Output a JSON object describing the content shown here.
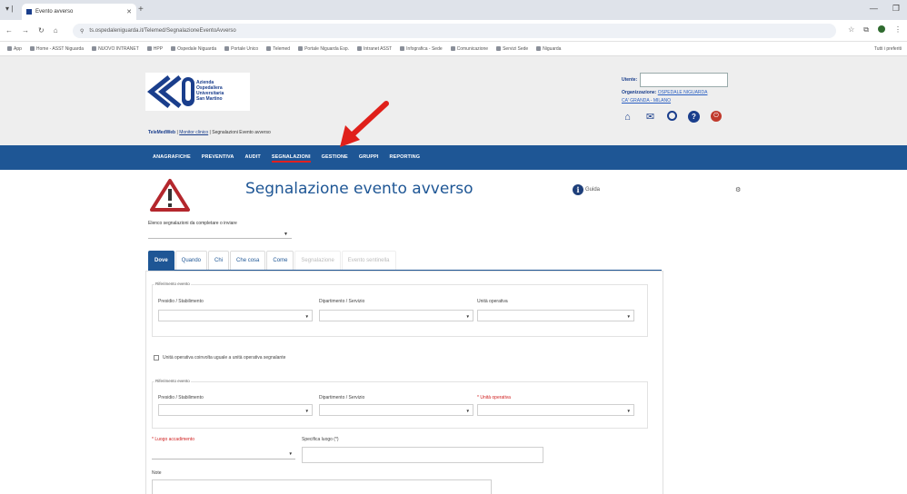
{
  "browser": {
    "tab_title": "Evento avverso",
    "url": "ts.ospedaleniguarda.it/Telemed/SegnalazioneEventoAvverso",
    "bookmarks": [
      "App",
      "Home - ASST Niguarda",
      "NUOVO INTRANET",
      "HPP",
      "Ospedale Niguarda",
      "Portale Unico",
      "Telemed",
      "Portale Niguarda Esp.",
      "Intranet ASST",
      "Infografica - Sede",
      "Comunicazione",
      "Servizi Sede",
      "Niguarda"
    ],
    "right_bookmark": "Tutti i preferiti"
  },
  "header": {
    "logo_lines": [
      "Azienda",
      "Ospedaliera",
      "Universitaria",
      "San Martino"
    ],
    "breadcrumb_home": "TeleMedWeb",
    "breadcrumb_link": "Monitor clinico",
    "breadcrumb_current": "Segnalazioni Evento avverso",
    "user_label": "Utente:",
    "org_label": "Organizzazione:",
    "org_value": "OSPEDALE NIGUARDA",
    "org_value2": "CA' GRANDA - MILANO"
  },
  "nav": {
    "items": [
      "ANAGRAFICHE",
      "PREVENTIVA",
      "AUDIT",
      "SEGNALAZIONI",
      "GESTIONE",
      "GRUPPI",
      "REPORTING"
    ]
  },
  "content": {
    "title": "Segnalazione evento avverso",
    "guide_label": "Guida",
    "elenco_label": "Elenco segnalazioni da completare o inviare",
    "tabs": [
      {
        "label": "Dove",
        "state": "active"
      },
      {
        "label": "Quando",
        "state": "normal"
      },
      {
        "label": "Chi",
        "state": "normal"
      },
      {
        "label": "Che cosa",
        "state": "normal"
      },
      {
        "label": "Come",
        "state": "normal"
      },
      {
        "label": "Segnalazione",
        "state": "disabled"
      },
      {
        "label": "Evento sentinella",
        "state": "disabled"
      }
    ],
    "section1_title": "Riferimento evento",
    "section1_fields": [
      "Presidio / Stabilimento",
      "Dipartimento / Servizio",
      "Unità operativa"
    ],
    "checkbox_label": "Unità operativa coinvolta uguale a unità operativa segnalante",
    "section2_title": "Riferimento evento",
    "section2_fields": [
      "Presidio / Stabilimento",
      "Dipartimento / Servizio",
      "* Unità operativa"
    ],
    "luogo_label": "* Luogo accadimento",
    "specifica_label": "Specifica luogo (*)",
    "note_label": "Note"
  }
}
